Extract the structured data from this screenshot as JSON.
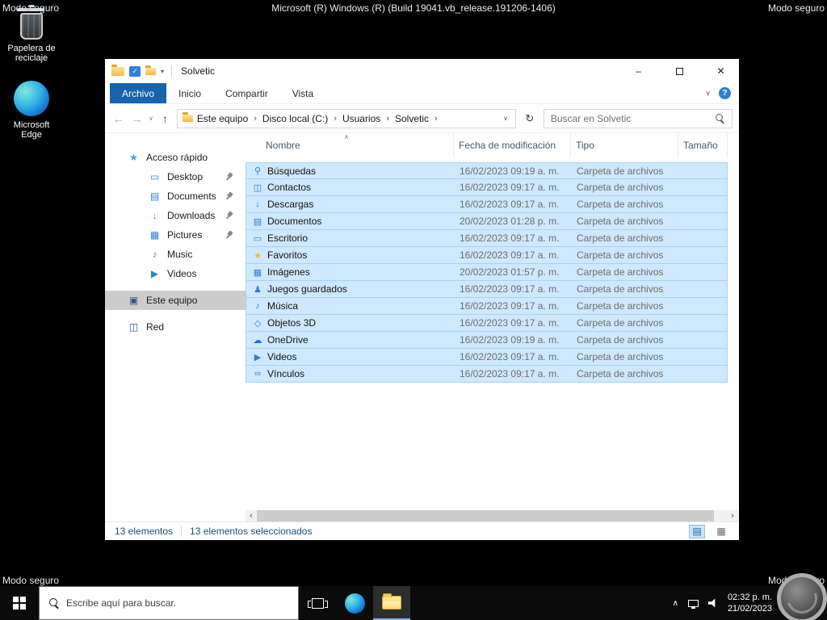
{
  "system": {
    "safe_mode_label": "Modo seguro",
    "build_text": "Microsoft (R) Windows (R) (Build 19041.vb_release.191206-1406)"
  },
  "desktop_icons": [
    {
      "label": "Papelera de reciclaje",
      "icon": "recycle-bin-icon"
    },
    {
      "label": "Microsoft Edge",
      "icon": "edge-icon"
    }
  ],
  "explorer": {
    "title": "Solvetic",
    "ribbon": {
      "tabs": [
        {
          "label": "Archivo",
          "active": true
        },
        {
          "label": "Inicio",
          "active": false
        },
        {
          "label": "Compartir",
          "active": false
        },
        {
          "label": "Vista",
          "active": false
        }
      ]
    },
    "breadcrumb": {
      "segments": [
        "Este equipo",
        "Disco local (C:)",
        "Usuarios",
        "Solvetic"
      ]
    },
    "search": {
      "placeholder": "Buscar en Solvetic"
    },
    "sidebar": [
      {
        "label": "Acceso rápido",
        "icon": "quick-access-icon",
        "level": 0,
        "pinned": false,
        "selected": false,
        "gap_before": false
      },
      {
        "label": "Desktop",
        "icon": "desktop-folder-icon",
        "level": 1,
        "pinned": true,
        "selected": false,
        "gap_before": false
      },
      {
        "label": "Documents",
        "icon": "documents-folder-icon",
        "level": 1,
        "pinned": true,
        "selected": false,
        "gap_before": false
      },
      {
        "label": "Downloads",
        "icon": "downloads-folder-icon",
        "level": 1,
        "pinned": true,
        "selected": false,
        "gap_before": false
      },
      {
        "label": "Pictures",
        "icon": "pictures-folder-icon",
        "level": 1,
        "pinned": true,
        "selected": false,
        "gap_before": false
      },
      {
        "label": "Music",
        "icon": "music-folder-icon",
        "level": 1,
        "pinned": false,
        "selected": false,
        "gap_before": false
      },
      {
        "label": "Videos",
        "icon": "videos-folder-icon",
        "level": 1,
        "pinned": false,
        "selected": false,
        "gap_before": false
      },
      {
        "label": "Este equipo",
        "icon": "this-pc-icon",
        "level": 0,
        "pinned": false,
        "selected": true,
        "gap_before": true
      },
      {
        "label": "Red",
        "icon": "network-icon",
        "level": 0,
        "pinned": false,
        "selected": false,
        "gap_before": true
      }
    ],
    "columns": [
      "Nombre",
      "Fecha de modificación",
      "Tipo",
      "Tamaño"
    ],
    "files": [
      {
        "name": "Búsquedas",
        "modified": "16/02/2023 09:19 a. m.",
        "type": "Carpeta de archivos",
        "size": "",
        "icon": "searches-folder-icon"
      },
      {
        "name": "Contactos",
        "modified": "16/02/2023 09:17 a. m.",
        "type": "Carpeta de archivos",
        "size": "",
        "icon": "contacts-folder-icon"
      },
      {
        "name": "Descargas",
        "modified": "16/02/2023 09:17 a. m.",
        "type": "Carpeta de archivos",
        "size": "",
        "icon": "downloads-folder-icon"
      },
      {
        "name": "Documentos",
        "modified": "20/02/2023 01:28 p. m.",
        "type": "Carpeta de archivos",
        "size": "",
        "icon": "documents-folder-icon"
      },
      {
        "name": "Escritorio",
        "modified": "16/02/2023 09:17 a. m.",
        "type": "Carpeta de archivos",
        "size": "",
        "icon": "desktop-folder-icon"
      },
      {
        "name": "Favoritos",
        "modified": "16/02/2023 09:17 a. m.",
        "type": "Carpeta de archivos",
        "size": "",
        "icon": "favorites-folder-icon"
      },
      {
        "name": "Imágenes",
        "modified": "20/02/2023 01:57 p. m.",
        "type": "Carpeta de archivos",
        "size": "",
        "icon": "pictures-folder-icon"
      },
      {
        "name": "Juegos guardados",
        "modified": "16/02/2023 09:17 a. m.",
        "type": "Carpeta de archivos",
        "size": "",
        "icon": "saved-games-folder-icon"
      },
      {
        "name": "Música",
        "modified": "16/02/2023 09:17 a. m.",
        "type": "Carpeta de archivos",
        "size": "",
        "icon": "music-folder-icon"
      },
      {
        "name": "Objetos 3D",
        "modified": "16/02/2023 09:17 a. m.",
        "type": "Carpeta de archivos",
        "size": "",
        "icon": "3d-objects-folder-icon"
      },
      {
        "name": "OneDrive",
        "modified": "16/02/2023 09:19 a. m.",
        "type": "Carpeta de archivos",
        "size": "",
        "icon": "onedrive-folder-icon"
      },
      {
        "name": "Videos",
        "modified": "16/02/2023 09:17 a. m.",
        "type": "Carpeta de archivos",
        "size": "",
        "icon": "videos-folder-icon"
      },
      {
        "name": "Vínculos",
        "modified": "16/02/2023 09:17 a. m.",
        "type": "Carpeta de archivos",
        "size": "",
        "icon": "links-folder-icon"
      }
    ],
    "status": {
      "count": "13 elementos",
      "selected": "13 elementos seleccionados"
    }
  },
  "taskbar": {
    "search_placeholder": "Escribe aquí para buscar.",
    "time": "02:32 p. m.",
    "date": "21/02/2023"
  },
  "glyphs": {
    "back": "←",
    "forward": "→",
    "up": "↑",
    "chevron-down": "∨",
    "chevron-up": "∧",
    "refresh": "↻",
    "breadcrumb-sep": "›",
    "scroll-left": "‹",
    "scroll-right": "›",
    "dropdown": "▾",
    "minimize": "–",
    "close": "✕",
    "check": "✓",
    "help": "?",
    "view-details": "▤",
    "view-icons": "▦"
  },
  "icons": {
    "searches-folder-icon": {
      "glyph": "⚲",
      "color": "#2f7fd0"
    },
    "contacts-folder-icon": {
      "glyph": "◫",
      "color": "#2f7fd0"
    },
    "downloads-folder-icon": {
      "glyph": "↓",
      "color": "#2f7fd0"
    },
    "documents-folder-icon": {
      "glyph": "▤",
      "color": "#2f7fd0"
    },
    "desktop-folder-icon": {
      "glyph": "▭",
      "color": "#2f7fd0"
    },
    "favorites-folder-icon": {
      "glyph": "★",
      "color": "#f2b632"
    },
    "pictures-folder-icon": {
      "glyph": "▦",
      "color": "#2f7fd0"
    },
    "saved-games-folder-icon": {
      "glyph": "♟",
      "color": "#2f7fd0"
    },
    "music-folder-icon": {
      "glyph": "♪",
      "color": "#2f7fd0"
    },
    "3d-objects-folder-icon": {
      "glyph": "◇",
      "color": "#2f7fd0"
    },
    "onedrive-folder-icon": {
      "glyph": "☁",
      "color": "#1173d4"
    },
    "videos-folder-icon": {
      "glyph": "▶",
      "color": "#2f7fd0"
    },
    "links-folder-icon": {
      "glyph": "∞",
      "color": "#2f7fd0"
    },
    "quick-access-icon": {
      "glyph": "★",
      "color": "#4a9de0"
    },
    "this-pc-icon": {
      "glyph": "▣",
      "color": "#33577b"
    },
    "network-icon": {
      "glyph": "◫",
      "color": "#33577b"
    }
  },
  "colors": {
    "accent_blue": "#1564ad",
    "selection_fill": "#cde8ff",
    "selection_border": "#a5d4f2",
    "sidebar_selected": "#cccccc",
    "taskbar_bg": "#0b0b0b",
    "taskbar_active_underline": "#76b9ed"
  }
}
